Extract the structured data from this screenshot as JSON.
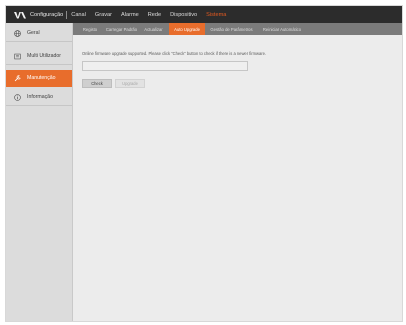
{
  "header": {
    "app_title": "Configuração",
    "menu": [
      {
        "label": "Canal"
      },
      {
        "label": "Gravar"
      },
      {
        "label": "Alarme"
      },
      {
        "label": "Rede"
      },
      {
        "label": "Dispositivo"
      },
      {
        "label": "Sistema",
        "active": true
      }
    ]
  },
  "sidebar": {
    "items": [
      {
        "label": "Geral",
        "icon": "globe-icon"
      },
      {
        "label": "Multi Utilizador",
        "icon": "users-icon"
      },
      {
        "label": "Manutenção",
        "icon": "wrench-icon",
        "active": true
      },
      {
        "label": "Informação",
        "icon": "info-icon"
      }
    ]
  },
  "tabs": [
    {
      "label": "Registo"
    },
    {
      "label": "Carregar Padrão"
    },
    {
      "label": "Actualizar"
    },
    {
      "label": "Auto Upgrade",
      "active": true
    },
    {
      "label": "Gestão de Parâmetros"
    },
    {
      "label": "Reiniciar Automático"
    }
  ],
  "main": {
    "info_text": "Online firmware upgrade supported. Please click \"Check\" button to check if there is a newer firmware.",
    "field_value": "",
    "check_label": "Check",
    "upgrade_label": "Upgrade"
  },
  "colors": {
    "accent": "#e86d2c",
    "topbar": "#2c2c2c",
    "tabbar": "#7b7b7b"
  }
}
